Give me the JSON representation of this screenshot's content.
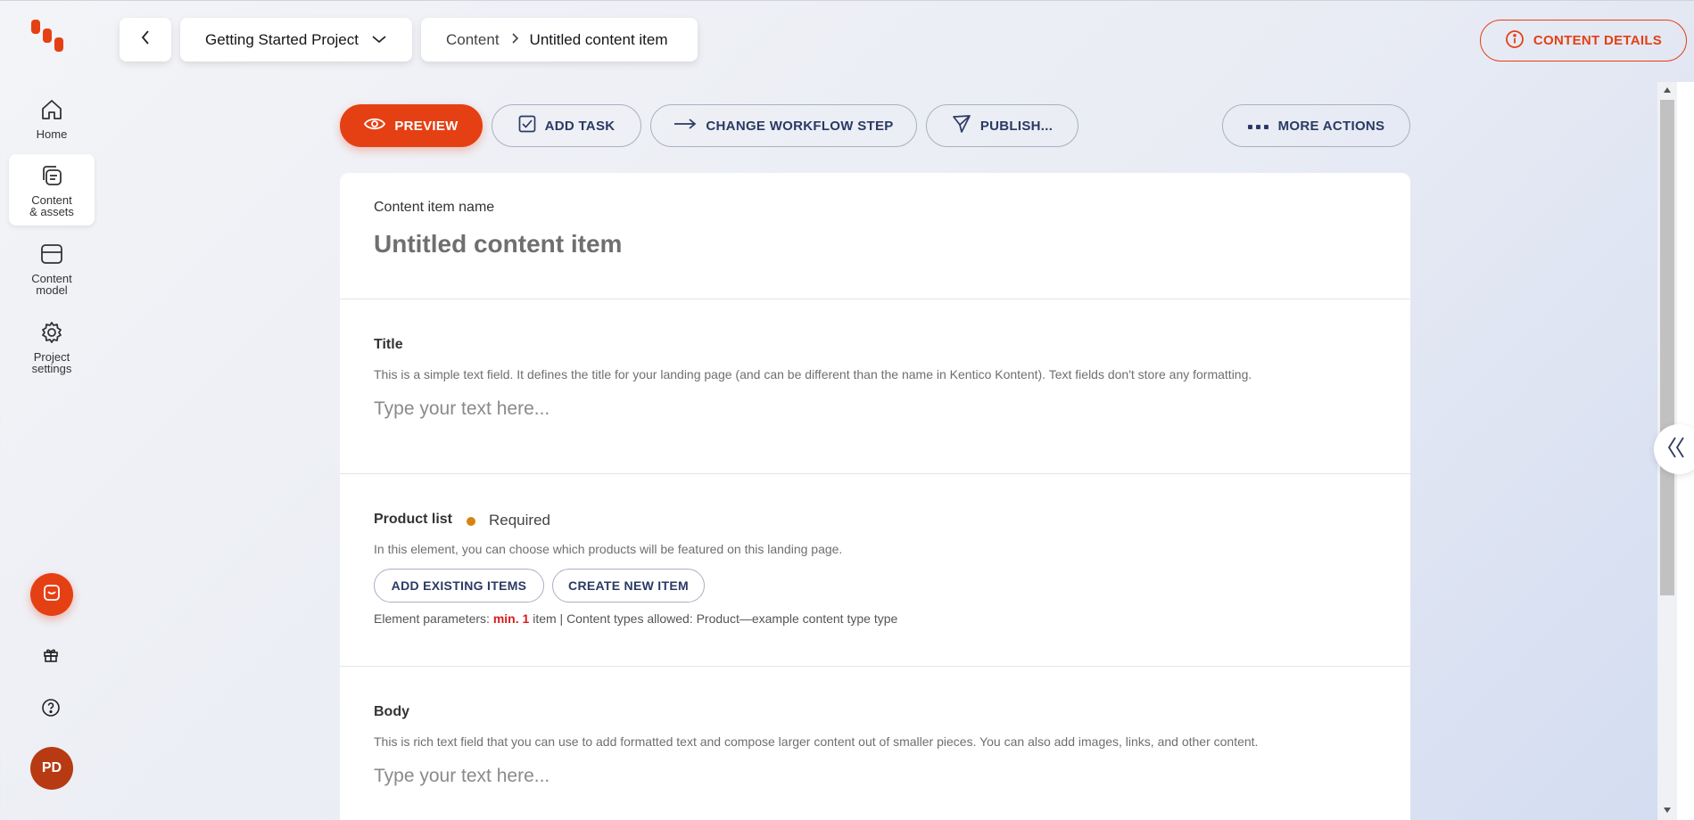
{
  "nav": {
    "items": [
      {
        "label": "Home",
        "icon": "home-icon"
      },
      {
        "label": "Content\n& assets",
        "icon": "content-assets-icon",
        "active": true
      },
      {
        "label": "Content\nmodel",
        "icon": "content-model-icon"
      },
      {
        "label": "Project\nsettings",
        "icon": "gear-icon"
      }
    ],
    "avatar_initials": "PD"
  },
  "header": {
    "project": "Getting Started Project",
    "breadcrumb": [
      "Content",
      "Untitled content item"
    ],
    "details_button": "CONTENT DETAILS"
  },
  "toolbar": {
    "preview": "PREVIEW",
    "add_task": "ADD TASK",
    "change_workflow": "CHANGE WORKFLOW STEP",
    "publish": "PUBLISH...",
    "more_actions": "MORE ACTIONS"
  },
  "item": {
    "name_label": "Content item name",
    "name_value": "Untitled content item",
    "title": {
      "label": "Title",
      "description": "This is a simple text field. It defines the title for your landing page (and can be different than the name in Kentico Kontent). Text fields don't store any formatting.",
      "placeholder": "Type your text here..."
    },
    "product_list": {
      "label": "Product list",
      "required": "Required",
      "description": "In this element, you can choose which products will be featured on this landing page.",
      "add_existing": "ADD EXISTING ITEMS",
      "create_new": "CREATE NEW ITEM",
      "params_prefix": "Element parameters:",
      "params_min": "min. 1",
      "params_suffix": "item | Content types allowed: Product—example content type type"
    },
    "body": {
      "label": "Body",
      "description": "This is rich text field that you can use to add formatted text and compose larger content out of smaller pieces. You can also add images, links, and other content.",
      "placeholder": "Type your text here..."
    }
  },
  "colors": {
    "accent": "#e54014",
    "primary_text": "#2b3a63",
    "required_dot": "#d68411",
    "error": "#d91c1c"
  }
}
